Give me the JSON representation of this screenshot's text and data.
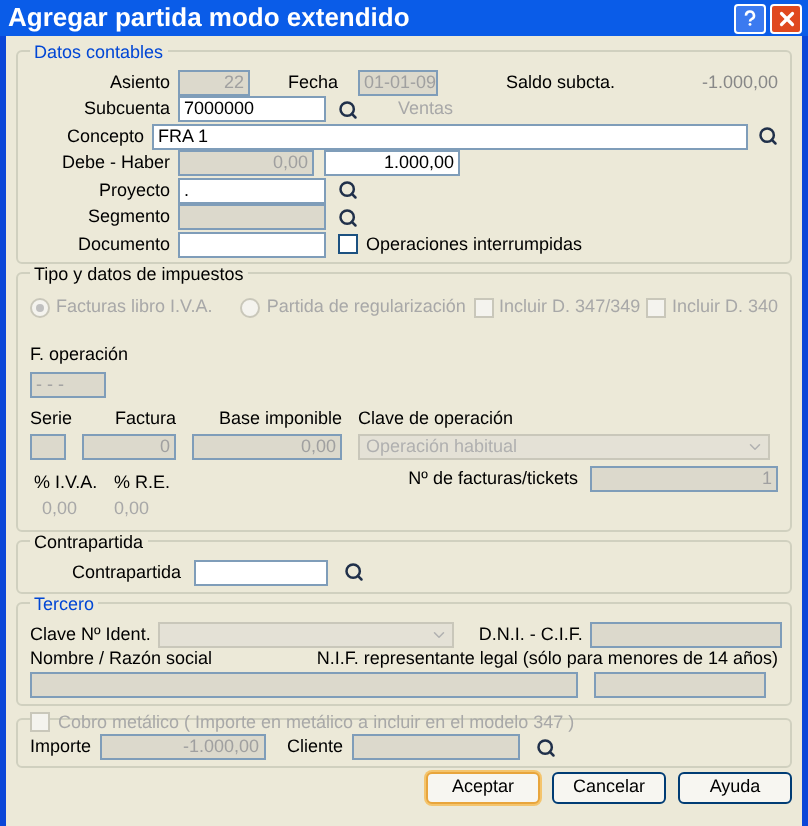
{
  "window": {
    "title": "Agregar partida modo extendido"
  },
  "datos_contables": {
    "title": "Datos contables",
    "asiento": {
      "label": "Asiento",
      "value": "22",
      "disabled": true
    },
    "fecha": {
      "label": "Fecha",
      "value": "01-01-09",
      "disabled": true
    },
    "saldo": {
      "label": "Saldo subcta.",
      "value": "-1.000,00"
    },
    "subcuenta": {
      "label": "Subcuenta",
      "value": "7000000",
      "description": "Ventas"
    },
    "concepto": {
      "label": "Concepto",
      "value": "FRA 1"
    },
    "debe_haber": {
      "label": "Debe - Haber",
      "debe": {
        "value": "0,00",
        "disabled": true
      },
      "haber": {
        "value": "1.000,00",
        "disabled": false
      }
    },
    "proyecto": {
      "label": "Proyecto",
      "value": "."
    },
    "segmento": {
      "label": "Segmento",
      "disabled": true
    },
    "documento": {
      "label": "Documento"
    },
    "operaciones_interrumpidas": {
      "label": "Operaciones interrumpidas",
      "checked": false
    }
  },
  "impuestos": {
    "title": "Tipo y datos de impuestos",
    "disabled": true,
    "options": [
      {
        "kind": "radio",
        "label": "Facturas libro I.V.A.",
        "selected": true
      },
      {
        "kind": "radio",
        "label": "Partida de regularización",
        "selected": false
      },
      {
        "kind": "checkbox",
        "label": "Incluir D. 347/349",
        "checked": false
      },
      {
        "kind": "checkbox",
        "label": "Incluir D. 340",
        "checked": false
      }
    ],
    "f_operacion": {
      "label": "F. operación",
      "value": "- - -"
    },
    "serie": {
      "label": "Serie"
    },
    "factura": {
      "label": "Factura",
      "value": "0"
    },
    "base_imponible": {
      "label": "Base imponible",
      "value": "0,00"
    },
    "clave_operacion": {
      "label": "Clave de operación",
      "value": "Operación habitual"
    },
    "num_facturas": {
      "label": "Nº de facturas/tickets",
      "value": "1"
    },
    "iva": {
      "label": "% I.V.A.",
      "value": "0,00"
    },
    "re": {
      "label": "% R.E.",
      "value": "0,00"
    }
  },
  "contrapartida": {
    "title": "Contrapartida",
    "label": "Contrapartida"
  },
  "tercero": {
    "title": "Tercero",
    "disabled": true,
    "clave": {
      "label": "Clave Nº Ident."
    },
    "dni": {
      "label": "D.N.I. - C.I.F."
    },
    "nombre": {
      "label": "Nombre / Razón social"
    },
    "nif_representante": {
      "label": "N.I.F. representante legal (sólo para menores de 14 años)"
    }
  },
  "cobro_metalico": {
    "label": "Cobro metálico ( Importe en metálico a incluir en el modelo 347 )",
    "checked": false,
    "disabled": true,
    "importe": {
      "label": "Importe",
      "value": "-1.000,00"
    },
    "cliente": {
      "label": "Cliente"
    }
  },
  "buttons": [
    {
      "label": "Aceptar",
      "focused": true
    },
    {
      "label": "Cancelar",
      "focused": false
    },
    {
      "label": "Ayuda",
      "focused": false
    }
  ]
}
